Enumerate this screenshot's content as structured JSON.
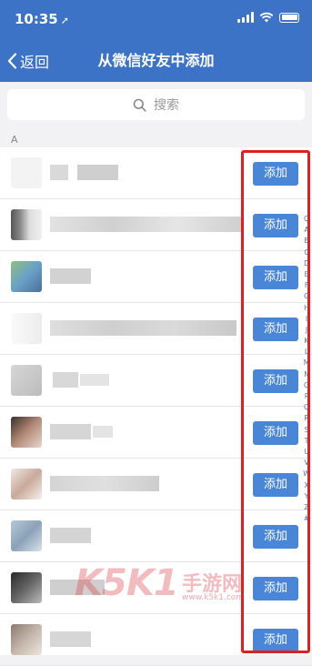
{
  "status": {
    "time": "10:35",
    "location_icon": "location-arrow-icon"
  },
  "nav": {
    "back_label": "返回",
    "title": "从微信好友中添加"
  },
  "search": {
    "placeholder": "搜索"
  },
  "section_header": "A",
  "contacts": [
    {
      "add_label": "添加"
    },
    {
      "add_label": "添加"
    },
    {
      "add_label": "添加"
    },
    {
      "add_label": "添加"
    },
    {
      "add_label": "添加"
    },
    {
      "add_label": "添加"
    },
    {
      "add_label": "添加"
    },
    {
      "add_label": "添加"
    },
    {
      "add_label": "添加"
    },
    {
      "add_label": "添加"
    }
  ],
  "index_letters": [
    "Q",
    "A",
    "B",
    "C",
    "D",
    "E",
    "F",
    "G",
    "H",
    "I",
    "J",
    "K",
    "L",
    "M",
    "N",
    "O",
    "P",
    "Q",
    "R",
    "S",
    "T",
    "U",
    "V",
    "W",
    "X",
    "Y",
    "Z",
    "#"
  ],
  "watermark": {
    "brand": "K5K1",
    "cn": "手游网",
    "url": "www.k5k1.com"
  },
  "colors": {
    "nav_bg": "#3d73c7",
    "button_bg": "#4a86d8",
    "highlight": "#e02020"
  }
}
